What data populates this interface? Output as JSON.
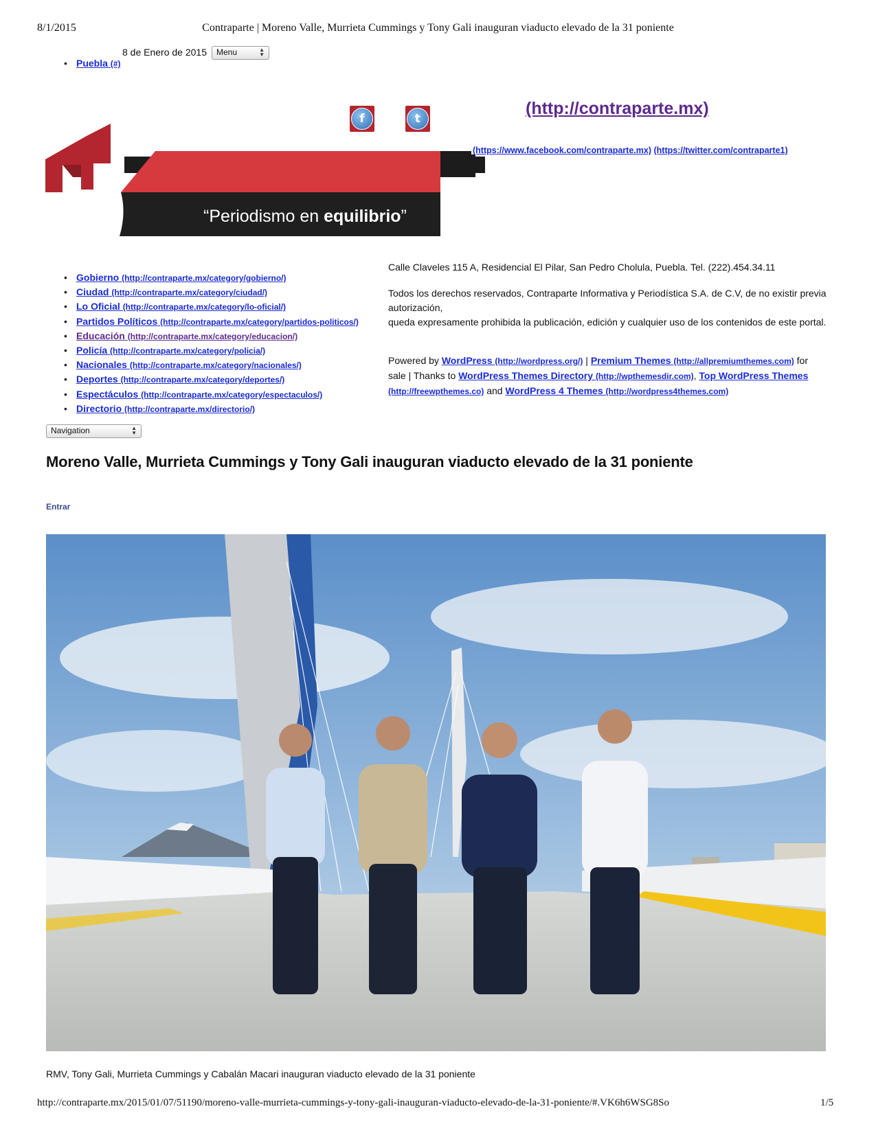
{
  "print_header": {
    "date": "8/1/2015",
    "title": "Contraparte | Moreno Valle, Murrieta Cummings y Tony Gali inauguran viaducto elevado de la 31 poniente"
  },
  "print_footer": {
    "url": "http://contraparte.mx/2015/01/07/51190/moreno-valle-murrieta-cummings-y-tony-gali-inauguran-viaducto-elevado-de-la-31-poniente/#.VK6h6WSG8So",
    "page": "1/5"
  },
  "site_date": "8 de Enero de 2015",
  "menu_select": {
    "value": "Menu"
  },
  "top_menu": [
    {
      "label": "Puebla",
      "url": "(#)"
    }
  ],
  "logo": {
    "brand": "CONTRAPARTE",
    "tagline_pre": "“Periodismo en ",
    "tagline_bold": "equilibrio",
    "tagline_post": "”"
  },
  "social": {
    "facebook_icon": "facebook-icon",
    "twitter_icon": "twitter-icon",
    "home_link": "(http://contraparte.mx)",
    "facebook_url": "(https://www.facebook.com/contraparte.mx)",
    "twitter_url": "(https://twitter.com/contraparte1)"
  },
  "categories": [
    {
      "label": "Gobierno",
      "url": "(http://contraparte.mx/category/gobierno/)"
    },
    {
      "label": "Ciudad",
      "url": "(http://contraparte.mx/category/ciudad/)"
    },
    {
      "label": "Lo Oficial",
      "url": "(http://contraparte.mx/category/lo-oficial/)"
    },
    {
      "label": "Partidos Políticos",
      "url": "(http://contraparte.mx/category/partidos-politicos/)"
    },
    {
      "label": "Educación",
      "url": "(http://contraparte.mx/category/educacion/)"
    },
    {
      "label": "Policía",
      "url": "(http://contraparte.mx/category/policia/)"
    },
    {
      "label": "Nacionales",
      "url": "(http://contraparte.mx/category/nacionales/)"
    },
    {
      "label": "Deportes",
      "url": "(http://contraparte.mx/category/deportes/)"
    },
    {
      "label": "Espectáculos",
      "url": "(http://contraparte.mx/category/espectaculos/)"
    },
    {
      "label": "Directorio",
      "url": "(http://contraparte.mx/directorio/)"
    }
  ],
  "navigation_select": {
    "value": "Navigation"
  },
  "contact": {
    "address": "Calle Claveles 115 A, Residencial El Pilar, San Pedro Cholula, Puebla. Tel. (222).454.34.11",
    "rights_line1": "Todos los derechos reservados, Contraparte Informativa y Periodística S.A. de C.V, de no existir previa autorización,",
    "rights_line2": "queda expresamente prohibida la publicación, edición y cualquier uso de los contenidos de este portal."
  },
  "powered": {
    "t1": "Powered by ",
    "wordpress": "WordPress",
    "wordpress_url": "(http://wordpress.org/)",
    "sep1": " | ",
    "premium": "Premium Themes",
    "premium_url": "(http://allpremiumthemes.com)",
    "t2": " for sale | Thanks to ",
    "directory": "WordPress Themes Directory",
    "directory_url": "(http://wpthemesdir.com)",
    "sep2": ", ",
    "top": "Top WordPress Themes",
    "top_url": "(http://freewpthemes.co)",
    "t3": " and ",
    "wp4": "WordPress 4 Themes",
    "wp4_url": "(http://wordpress4themes.com)"
  },
  "article": {
    "title": "Moreno Valle, Murrieta Cummings y Tony Gali inauguran viaducto elevado de la 31 poniente",
    "login": "Entrar",
    "caption": "RMV, Tony Gali, Murrieta Cummings y Cabalán Macari inauguran viaducto elevado de la 31 poniente"
  }
}
